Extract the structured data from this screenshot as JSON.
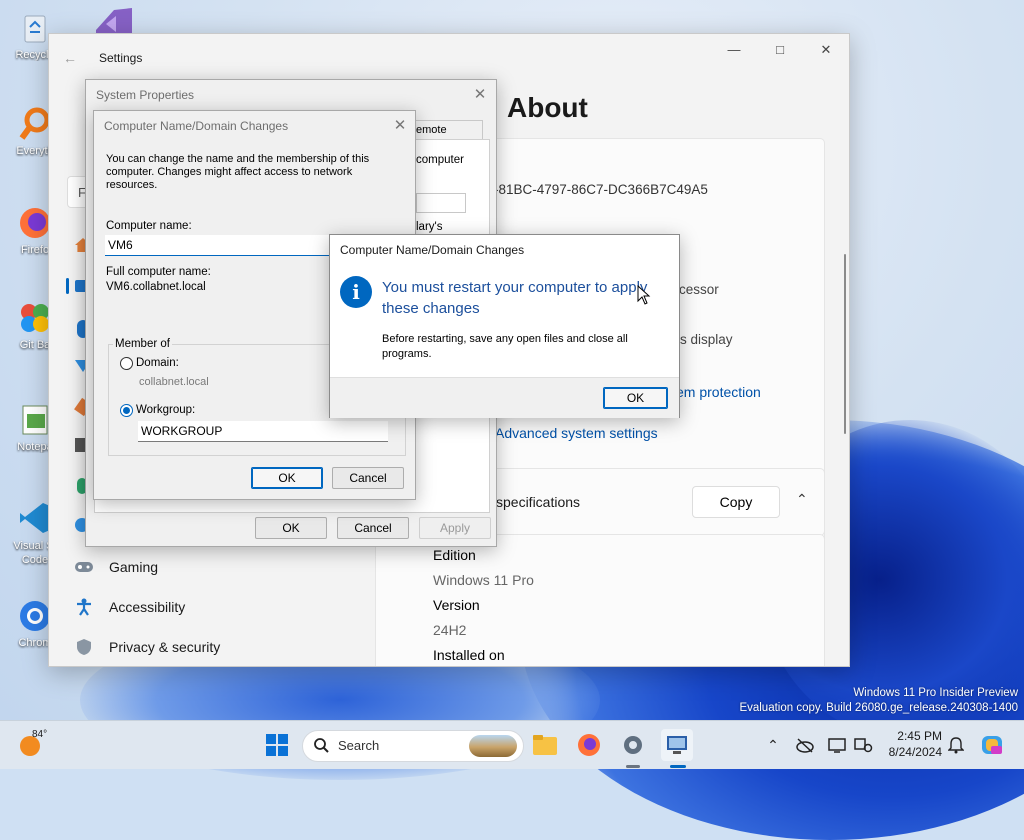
{
  "desktop": {
    "icons": [
      {
        "label": "Recycle Bin",
        "shown": "Recycle"
      },
      {
        "label": "Everything",
        "shown": "Everyth"
      },
      {
        "label": "Firefox",
        "shown": "Firefo"
      },
      {
        "label": "Git Bash",
        "shown": "Git Ba"
      },
      {
        "label": "Notepad",
        "shown": "Notepa"
      },
      {
        "label": "Visual Studio Code",
        "shown": "Visual St Code"
      },
      {
        "label": "Chrome",
        "shown": "Chrom"
      }
    ],
    "watermark": {
      "line1": "Windows 11 Pro Insider Preview",
      "line2": "Evaluation copy. Build 26080.ge_release.240308-1400"
    }
  },
  "settings": {
    "title": "Settings",
    "search_placeholder_partial": "Fi",
    "page_title": "About",
    "device_id_partial": "-81BC-4797-86C7-DC366B7C49A5",
    "processor_partial": "cessor",
    "pen_touch_partial": "is display",
    "system_protection_link": "em protection",
    "advanced_link": "Advanced system settings",
    "windows_specs_header": "specifications",
    "copy_button": "Copy",
    "specs": [
      {
        "label": "Edition",
        "value": "Windows 11 Pro"
      },
      {
        "label": "Version",
        "value": "24H2"
      },
      {
        "label": "Installed on",
        "value": ""
      }
    ],
    "nav": [
      {
        "label": "Gaming"
      },
      {
        "label": "Accessibility"
      },
      {
        "label": "Privacy & security"
      }
    ]
  },
  "system_properties": {
    "title": "System Properties",
    "tab_partial": "emote",
    "side_text_1": "computer",
    "side_text_2": "lary's",
    "ok": "OK",
    "cancel": "Cancel",
    "apply": "Apply"
  },
  "name_changes": {
    "title": "Computer Name/Domain Changes",
    "intro": "You can change the name and the membership of this computer. Changes might affect access to network resources.",
    "computer_name_label": "Computer name:",
    "computer_name_value": "VM6",
    "full_name_label": "Full computer name:",
    "full_name_value": "VM6.collabnet.local",
    "member_of_label": "Member of",
    "domain_label": "Domain:",
    "domain_value": "collabnet.local",
    "workgroup_label": "Workgroup:",
    "workgroup_value": "WORKGROUP",
    "ok": "OK",
    "cancel": "Cancel"
  },
  "restart_dialog": {
    "title": "Computer Name/Domain Changes",
    "main_instruction": "You must restart your computer to apply these changes",
    "detail": "Before restarting, save any open files and close all programs.",
    "ok": "OK"
  },
  "taskbar": {
    "weather_temp": "84°",
    "search_label": "Search",
    "time": "2:45 PM",
    "date": "8/24/2024",
    "accent": "#0067c0"
  }
}
